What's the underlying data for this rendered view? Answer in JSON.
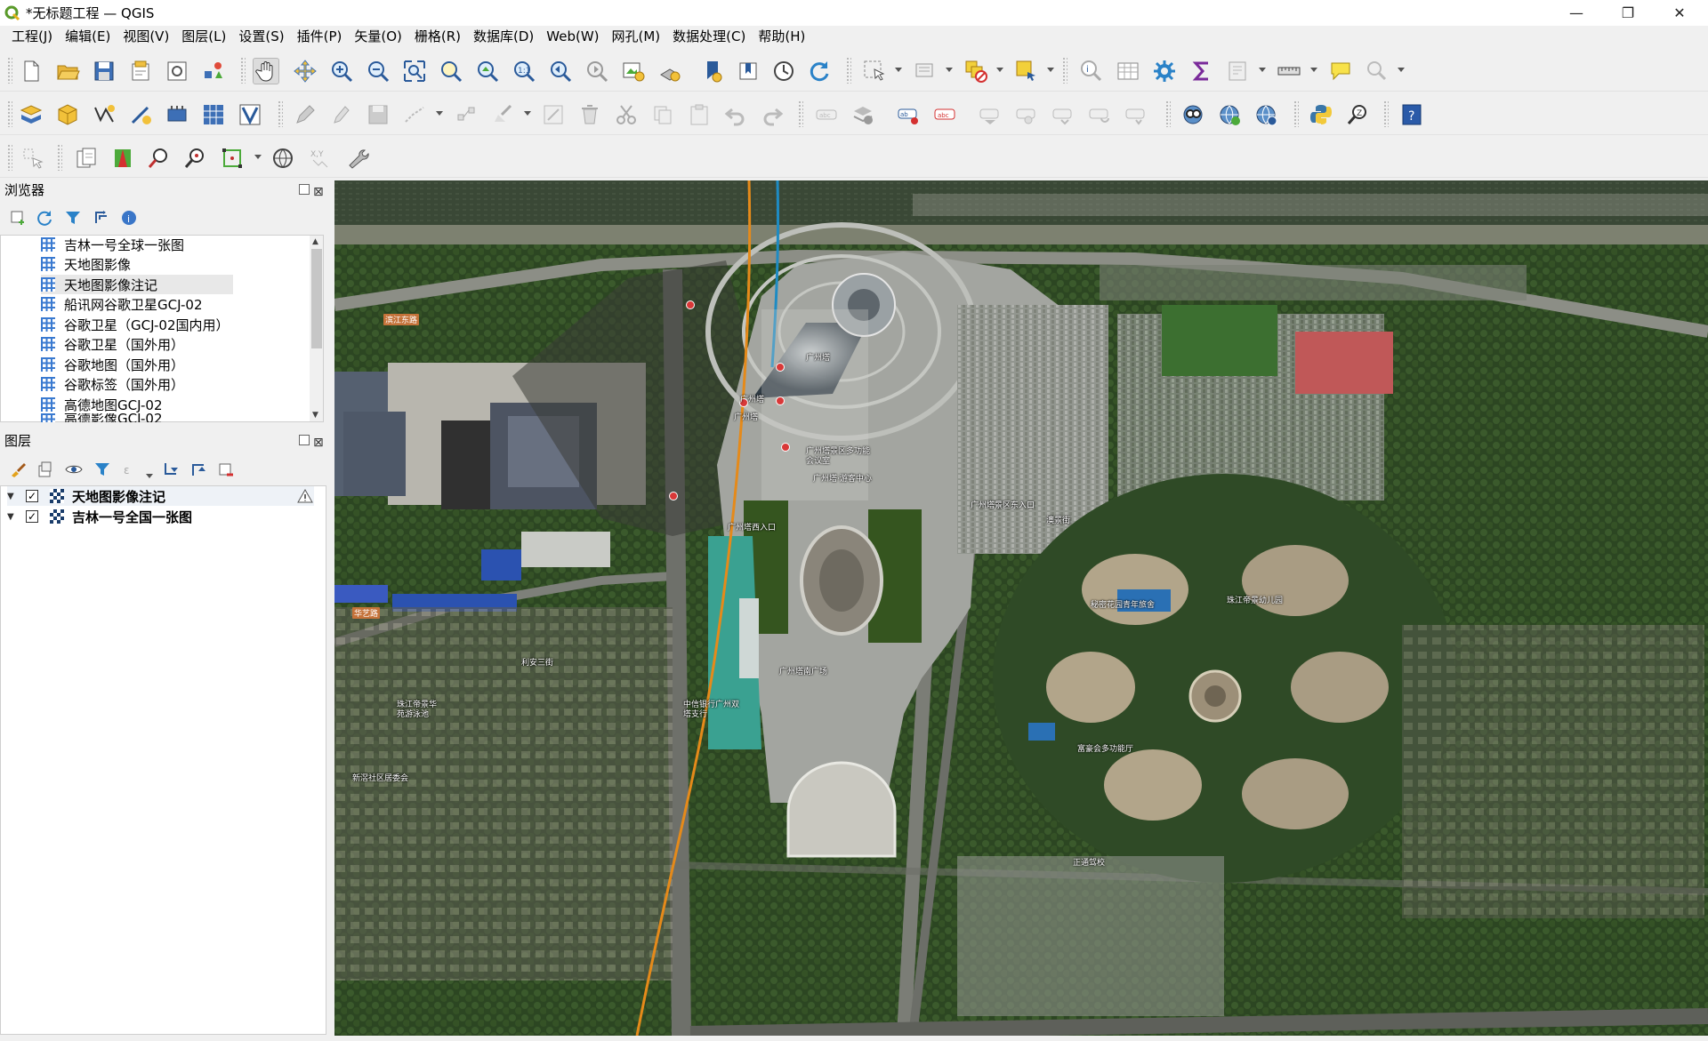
{
  "window": {
    "title": "*无标题工程 — QGIS",
    "minimize": "—",
    "maximize": "❐",
    "close": "✕"
  },
  "menubar": {
    "items": [
      "工程(J)",
      "编辑(E)",
      "视图(V)",
      "图层(L)",
      "设置(S)",
      "插件(P)",
      "矢量(O)",
      "栅格(R)",
      "数据库(D)",
      "Web(W)",
      "网孔(M)",
      "数据处理(C)",
      "帮助(H)"
    ]
  },
  "browser_panel": {
    "title": "浏览器",
    "items": [
      {
        "label": "吉林一号全球一张图",
        "selected": false
      },
      {
        "label": "天地图影像",
        "selected": false
      },
      {
        "label": "天地图影像注记",
        "selected": true
      },
      {
        "label": "船讯网谷歌卫星GCJ-02",
        "selected": false
      },
      {
        "label": "谷歌卫星（GCJ-02国内用）",
        "selected": false
      },
      {
        "label": "谷歌卫星（国外用）",
        "selected": false
      },
      {
        "label": "谷歌地图（国外用）",
        "selected": false
      },
      {
        "label": "谷歌标签（国外用）",
        "selected": false
      },
      {
        "label": "高德地图GCJ-02",
        "selected": false
      },
      {
        "label": "高德影像GCJ-02",
        "selected": false
      }
    ]
  },
  "layers_panel": {
    "title": "图层",
    "layers": [
      {
        "name": "天地图影像注记",
        "checked": true,
        "warning": true
      },
      {
        "name": "吉林一号全国一张图",
        "checked": true,
        "warning": false
      }
    ]
  },
  "map": {
    "labels": [
      {
        "text": "广州塔",
        "kind": "poi"
      },
      {
        "text": "广州塔",
        "kind": "poi"
      },
      {
        "text": "广州塔",
        "kind": "poi"
      },
      {
        "text": "广州塔景区多功能会议室",
        "kind": "poi"
      },
      {
        "text": "广州塔·游客中心",
        "kind": "poi"
      },
      {
        "text": "广州塔西入口",
        "kind": "poi"
      },
      {
        "text": "广州塔景区东入口",
        "kind": "poi"
      },
      {
        "text": "秘密花园青年旅舍",
        "kind": "poi"
      },
      {
        "text": "珠江帝景幼儿园",
        "kind": "poi"
      },
      {
        "text": "富豪会多功能厅",
        "kind": "poi"
      },
      {
        "text": "珠江帝景华苑游泳池",
        "kind": "poi"
      },
      {
        "text": "中信银行广州双塔支行",
        "kind": "poi"
      },
      {
        "text": "新滘社区居委会",
        "kind": "poi"
      },
      {
        "text": "利安三街",
        "kind": "road"
      },
      {
        "text": "华艺路",
        "kind": "road"
      },
      {
        "text": "滨江东路",
        "kind": "road"
      },
      {
        "text": "澳景街",
        "kind": "road"
      },
      {
        "text": "广州塔南广场",
        "kind": "poi"
      },
      {
        "text": "正通驾校",
        "kind": "poi"
      }
    ]
  },
  "colors": {
    "river": "#3b4a38",
    "vegetation": "#2f4a22",
    "plaza": "#a8aaa6",
    "road_label": "#c5733a",
    "metro_orange": "#e58a1a",
    "metro_blue": "#1e8bc3"
  }
}
